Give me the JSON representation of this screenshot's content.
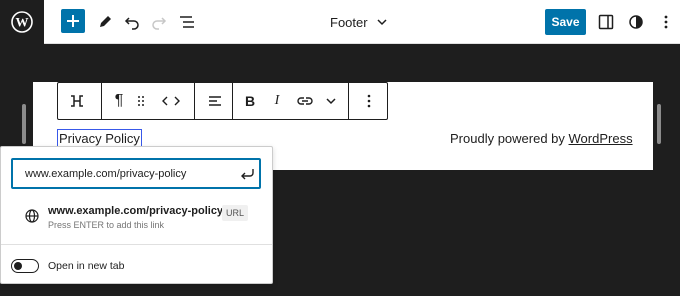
{
  "topbar": {
    "document_title": "Footer",
    "save_label": "Save",
    "icons": [
      "wordpress-logo",
      "plus-icon",
      "pencil-icon",
      "undo-icon",
      "redo-icon",
      "list-view-icon",
      "chevron-down-icon",
      "sidebar-icon",
      "contrast-icon",
      "more-vertical-icon"
    ]
  },
  "canvas": {
    "privacy_text": "Privacy Policy",
    "powered_prefix": "Proudly powered by ",
    "powered_link": "WordPress"
  },
  "block_toolbar": {
    "icons": [
      "link-unlink-icon",
      "paragraph-icon",
      "drag-handle-icon",
      "code-chevrons-icon",
      "align-icon",
      "bold-icon",
      "italic-icon",
      "link-icon",
      "chevron-down-icon",
      "more-vertical-icon"
    ],
    "bold_label": "B",
    "italic_label": "I",
    "paragraph_label": "¶"
  },
  "link_popover": {
    "url_value": "www.example.com/privacy-policy",
    "suggestion_title": "www.example.com/privacy-policy",
    "suggestion_hint": "Press ENTER to add this link",
    "suggestion_type": "URL",
    "new_tab_label": "Open in new tab",
    "new_tab_enabled": false
  },
  "colors": {
    "accent": "#0073aa",
    "dark": "#1e1e1e",
    "selection": "#3858e9"
  }
}
